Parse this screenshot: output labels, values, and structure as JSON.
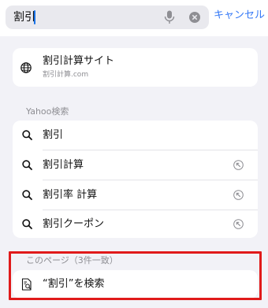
{
  "search": {
    "query": "割引",
    "cancel_label": "キャンセル"
  },
  "site_suggestion": {
    "title": "割引計算サイト",
    "url": "割引計算.com"
  },
  "yahoo_section": {
    "label": "Yahoo検索",
    "items": [
      {
        "label": "割引"
      },
      {
        "label": "割引計算"
      },
      {
        "label": "割引率 計算"
      },
      {
        "label": "割引クーポン"
      }
    ]
  },
  "on_page": {
    "label": "このページ（3件一致）",
    "search_label": "“割引”を検索"
  },
  "colors": {
    "accent": "#3478f6",
    "highlight": "#e01a1a"
  },
  "icons": [
    "microphone-icon",
    "clear-icon",
    "globe-icon",
    "search-icon",
    "fill-arrow-icon",
    "document-search-icon"
  ]
}
